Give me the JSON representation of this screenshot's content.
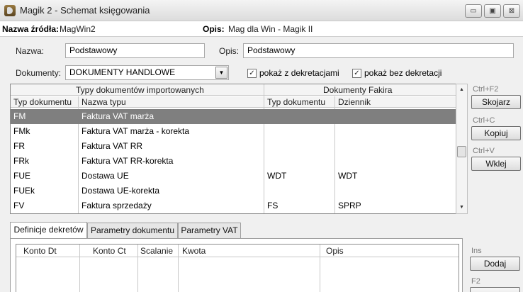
{
  "window": {
    "title": "Magik 2 - Schemat księgowania",
    "minimize": "▭",
    "maximize": "▣",
    "close": "⊠"
  },
  "source": {
    "name_label": "Nazwa źródła:",
    "name_value": "MagWin2",
    "desc_label": "Opis:",
    "desc_value": "Mag dla Win - Magik II"
  },
  "form": {
    "nazwa_label": "Nazwa:",
    "nazwa_value": "Podstawowy",
    "opis_label": "Opis:",
    "opis_value": "Podstawowy",
    "dokumenty_label": "Dokumenty:",
    "dokumenty_value": "DOKUMENTY HANDLOWE"
  },
  "checkboxes": [
    {
      "label": "pokaż z dekretacjami",
      "checked": true
    },
    {
      "label": "pokaż bez dekretacji",
      "checked": true
    }
  ],
  "grid": {
    "group_imported": "Typy dokumentów importowanych",
    "group_fakir": "Dokumenty Fakira",
    "columns": [
      "Typ dokumentu",
      "Nazwa typu",
      "Typ dokumentu",
      "Dziennik"
    ],
    "rows": [
      {
        "typ": "FM",
        "nazwa": "Faktura VAT marża",
        "fakir_typ": "",
        "dziennik": "",
        "selected": true
      },
      {
        "typ": "FMk",
        "nazwa": "Faktura VAT marża - korekta",
        "fakir_typ": "",
        "dziennik": "",
        "selected": false
      },
      {
        "typ": "FR",
        "nazwa": "Faktura VAT RR",
        "fakir_typ": "",
        "dziennik": "",
        "selected": false
      },
      {
        "typ": "FRk",
        "nazwa": "Faktura VAT RR-korekta",
        "fakir_typ": "",
        "dziennik": "",
        "selected": false
      },
      {
        "typ": "FUE",
        "nazwa": "Dostawa UE",
        "fakir_typ": "WDT",
        "dziennik": "WDT",
        "selected": false
      },
      {
        "typ": "FUEk",
        "nazwa": "Dostawa UE-korekta",
        "fakir_typ": "",
        "dziennik": "",
        "selected": false
      },
      {
        "typ": "FV",
        "nazwa": "Faktura sprzedaży",
        "fakir_typ": "FS",
        "dziennik": "SPRP",
        "selected": false
      }
    ]
  },
  "side_buttons": [
    {
      "shortcut": "Ctrl+F2",
      "label": "Skojarz"
    },
    {
      "shortcut": "Ctrl+C",
      "label": "Kopiuj"
    },
    {
      "shortcut": "Ctrl+V",
      "label": "Wklej"
    }
  ],
  "tabs": [
    "Definicje dekretów",
    "Parametry dokumentu",
    "Parametry VAT"
  ],
  "dekrety": {
    "columns": [
      "Konto Dt",
      "Konto Ct",
      "Scalanie",
      "Kwota",
      "Opis"
    ]
  },
  "bottom_buttons": [
    {
      "shortcut": "Ins",
      "label": "Dodaj"
    },
    {
      "shortcut": "F2",
      "label": ""
    }
  ],
  "colors": {
    "selected_row": "#7f7f7f",
    "window_bg": "#f0f0f0"
  }
}
